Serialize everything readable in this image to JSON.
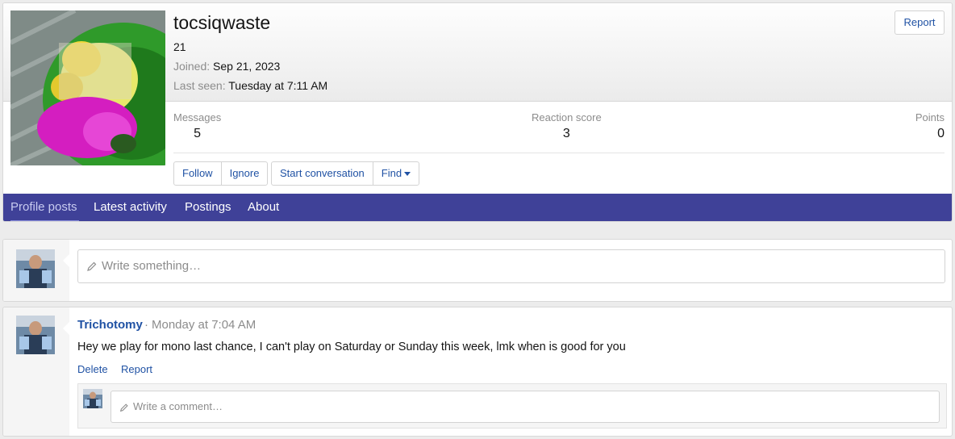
{
  "profile": {
    "username": "tocsiqwaste",
    "user_title": "21",
    "joined_label": "Joined:",
    "joined_value": "Sep 21, 2023",
    "lastseen_label": "Last seen:",
    "lastseen_value": "Tuesday at 7:11 AM",
    "report_label": "Report"
  },
  "stats": {
    "messages_label": "Messages",
    "messages_value": "5",
    "reaction_label": "Reaction score",
    "reaction_value": "3",
    "points_label": "Points",
    "points_value": "0"
  },
  "actions": {
    "follow": "Follow",
    "ignore": "Ignore",
    "start_conversation": "Start conversation",
    "find": "Find"
  },
  "tabs": [
    "Profile posts",
    "Latest activity",
    "Postings",
    "About"
  ],
  "composer": {
    "placeholder": "Write something…"
  },
  "post": {
    "author": "Trichotomy",
    "separator": "·",
    "time": "Monday at 7:04 AM",
    "body": "Hey we play for mono last chance, I can't play on Saturday or Sunday this week, lmk when is good for you",
    "delete_label": "Delete",
    "report_label": "Report",
    "comment_placeholder": "Write a comment…"
  },
  "icons": {
    "pencil": "pencil-icon",
    "dropdown": "caret-down-icon"
  },
  "colors": {
    "nav_background": "#3f4198",
    "link": "#2052a4"
  }
}
